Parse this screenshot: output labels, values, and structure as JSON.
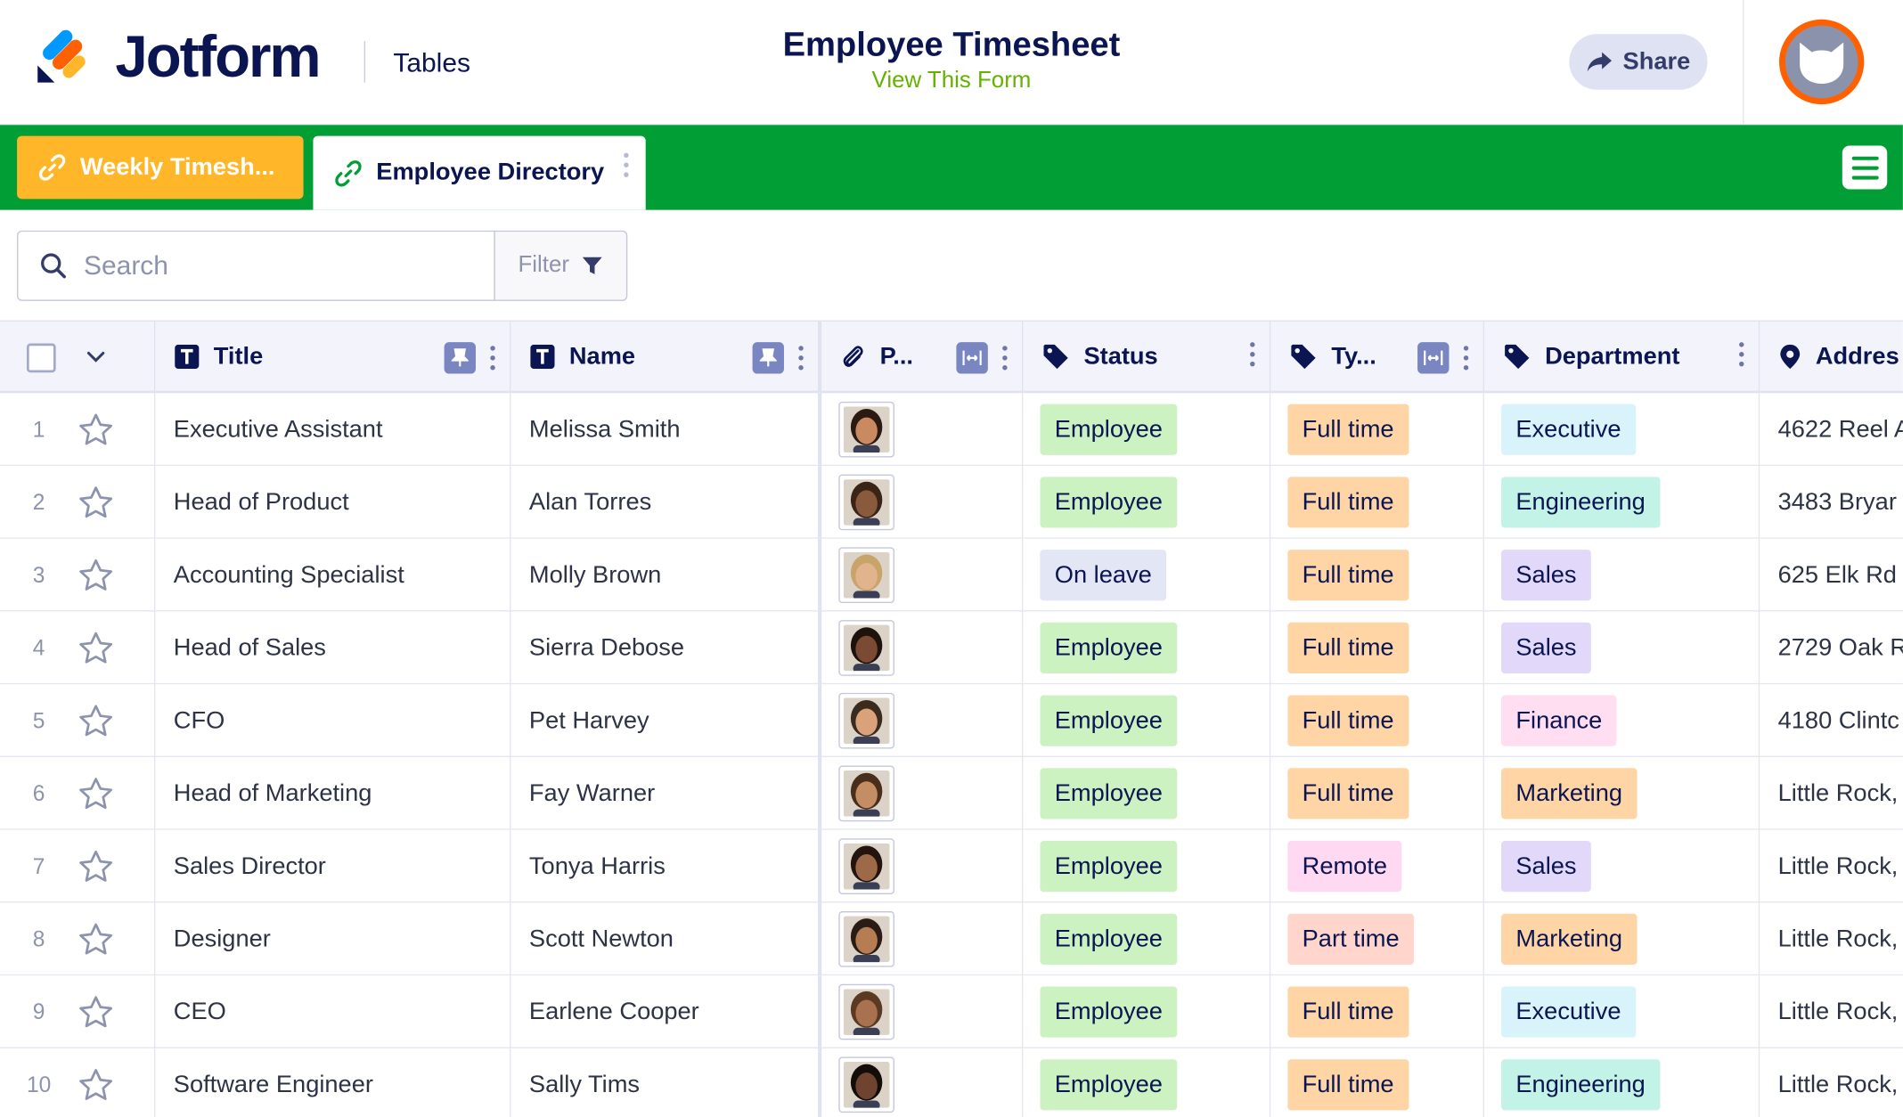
{
  "app": {
    "brand": "Jotform",
    "product": "Tables",
    "form_title": "Employee Timesheet",
    "form_link": "View This Form",
    "share_label": "Share",
    "accent_green": "#009e35",
    "accent_orange": "#ffb629"
  },
  "tabs": [
    {
      "label": "Weekly Timesh...",
      "icon": "link-icon",
      "active": false
    },
    {
      "label": "Employee Directory",
      "icon": "link-icon",
      "active": true
    }
  ],
  "search": {
    "placeholder": "Search",
    "filter_label": "Filter"
  },
  "columns": [
    {
      "label": "Title",
      "icon": "text-icon"
    },
    {
      "label": "Name",
      "icon": "text-icon"
    },
    {
      "label": "P...",
      "icon": "paperclip-icon"
    },
    {
      "label": "Status",
      "icon": "tag-icon"
    },
    {
      "label": "Ty...",
      "icon": "tag-icon"
    },
    {
      "label": "Department",
      "icon": "tag-icon"
    },
    {
      "label": "Addres",
      "icon": "location-pin-icon"
    }
  ],
  "badge_colors": {
    "Employee": "#cdf2c2",
    "On leave": "#e3e6f5",
    "Full time": "#ffd5a6",
    "Part time": "#ffd5cc",
    "Remote": "#ffd9f2",
    "Executive": "#d9f3fa",
    "Engineering": "#c3f2e6",
    "Sales": "#e2d9fa",
    "Finance": "#ffdef2",
    "Marketing": "#ffd5a6"
  },
  "rows": [
    {
      "num": "1",
      "title": "Executive Assistant",
      "name": "Melissa Smith",
      "status": "Employee",
      "type": "Full time",
      "department": "Executive",
      "address": "4622 Reel A"
    },
    {
      "num": "2",
      "title": "Head of Product",
      "name": "Alan Torres",
      "status": "Employee",
      "type": "Full time",
      "department": "Engineering",
      "address": "3483 Bryar"
    },
    {
      "num": "3",
      "title": "Accounting Specialist",
      "name": "Molly Brown",
      "status": "On leave",
      "type": "Full time",
      "department": "Sales",
      "address": "625 Elk Rd"
    },
    {
      "num": "4",
      "title": "Head of Sales",
      "name": "Sierra Debose",
      "status": "Employee",
      "type": "Full time",
      "department": "Sales",
      "address": "2729 Oak R"
    },
    {
      "num": "5",
      "title": "CFO",
      "name": "Pet Harvey",
      "status": "Employee",
      "type": "Full time",
      "department": "Finance",
      "address": "4180 Clintc"
    },
    {
      "num": "6",
      "title": "Head of Marketing",
      "name": "Fay Warner",
      "status": "Employee",
      "type": "Full time",
      "department": "Marketing",
      "address": "Little Rock,"
    },
    {
      "num": "7",
      "title": "Sales Director",
      "name": "Tonya Harris",
      "status": "Employee",
      "type": "Remote",
      "department": "Sales",
      "address": "Little Rock,"
    },
    {
      "num": "8",
      "title": "Designer",
      "name": "Scott Newton",
      "status": "Employee",
      "type": "Part time",
      "department": "Marketing",
      "address": "Little Rock,"
    },
    {
      "num": "9",
      "title": "CEO",
      "name": "Earlene Cooper",
      "status": "Employee",
      "type": "Full time",
      "department": "Executive",
      "address": "Little Rock,"
    },
    {
      "num": "10",
      "title": "Software Engineer",
      "name": "Sally Tims",
      "status": "Employee",
      "type": "Full time",
      "department": "Engineering",
      "address": "Little Rock,"
    }
  ]
}
